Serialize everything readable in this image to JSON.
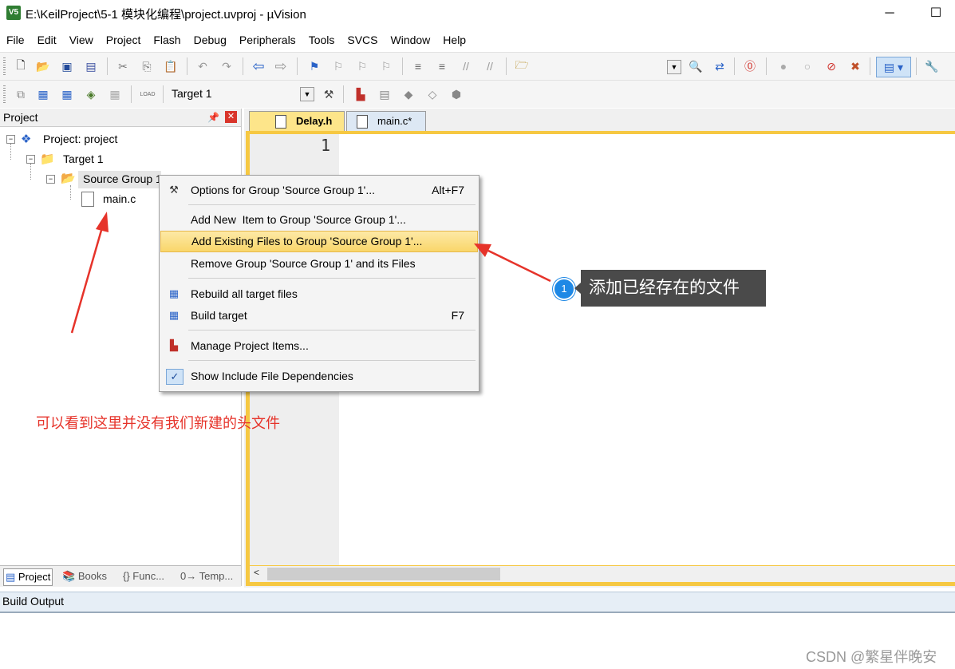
{
  "window": {
    "title": "E:\\KeilProject\\5-1 模块化编程\\project.uvproj - µVision",
    "app_icon": "keil-uvision-icon",
    "minimize": "─",
    "maximize": "☐"
  },
  "menu": [
    "File",
    "Edit",
    "View",
    "Project",
    "Flash",
    "Debug",
    "Peripherals",
    "Tools",
    "SVCS",
    "Window",
    "Help"
  ],
  "toolbar2": {
    "target_value": "Target 1",
    "load_label": "LOAD"
  },
  "project_pane": {
    "title": "Project",
    "tree": {
      "root": "Project: project",
      "target": "Target 1",
      "group": "Source Group 1",
      "file": "main.c"
    },
    "tabs": [
      "Project",
      "Books",
      "{} Func...",
      "0→ Temp..."
    ]
  },
  "editor": {
    "tabs": [
      {
        "label": "Delay.h",
        "active": true
      },
      {
        "label": "main.c*",
        "active": false
      }
    ],
    "line_number": "1",
    "frame_color": "#f6c842"
  },
  "context_menu": {
    "items": [
      {
        "label": "Options for Group 'Source Group 1'...",
        "shortcut": "Alt+F7",
        "icon": "options-wand-icon"
      },
      {
        "label": "Add New  Item to Group 'Source Group 1'...",
        "shortcut": "",
        "icon": ""
      },
      {
        "label": "Add Existing Files to Group 'Source Group 1'...",
        "shortcut": "",
        "icon": "",
        "highlighted": true
      },
      {
        "label": "Remove Group 'Source Group 1' and its Files",
        "shortcut": "",
        "icon": ""
      },
      {
        "label": "Rebuild all target files",
        "shortcut": "",
        "icon": "rebuild-icon"
      },
      {
        "label": "Build target",
        "shortcut": "F7",
        "icon": "build-icon"
      },
      {
        "label": "Manage Project Items...",
        "shortcut": "",
        "icon": "manage-items-icon"
      },
      {
        "label": "Show Include File Dependencies",
        "shortcut": "",
        "icon": "checkmark-icon"
      }
    ]
  },
  "build_output": {
    "title": "Build Output"
  },
  "annotations": {
    "red_note": "可以看到这里并没有我们新建的头文件",
    "callout_number": "1",
    "callout_text": "添加已经存在的文件",
    "accent_red": "#e6332a",
    "callout_blue": "#1e88e5"
  },
  "watermark": "CSDN @繁星伴晚安"
}
